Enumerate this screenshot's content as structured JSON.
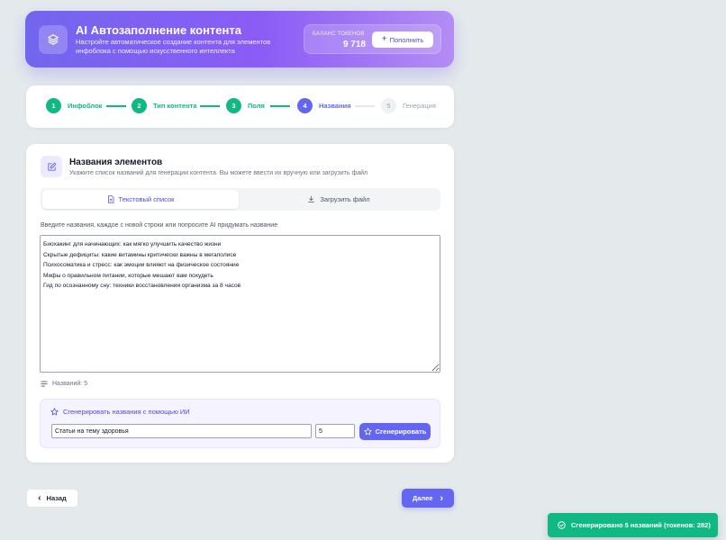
{
  "header": {
    "title": "AI Автозаполнение контента",
    "subtitle": "Настройте автоматическое создание контента для элементов инфоблока с помощью искусственного интеллекта",
    "logo_icon": "layers-icon",
    "balance_label": "БАЛАНС ТОКЕНОВ",
    "balance_value": "9 718",
    "topup_label": "Пополнить"
  },
  "steps": [
    {
      "number": "1",
      "label": "Инфоблок",
      "state": "done"
    },
    {
      "number": "2",
      "label": "Тип контента",
      "state": "done"
    },
    {
      "number": "3",
      "label": "Поля",
      "state": "done"
    },
    {
      "number": "4",
      "label": "Названия",
      "state": "active"
    },
    {
      "number": "5",
      "label": "Генерация",
      "state": "pending"
    }
  ],
  "section": {
    "title": "Названия элементов",
    "subtitle": "Укажите список названий для генерации контента. Вы можете ввести их вручную или загрузить файл",
    "icon": "edit-icon",
    "tabs": [
      {
        "label": "Текстовый список",
        "icon": "document-icon",
        "active": true
      },
      {
        "label": "Загрузить файл",
        "icon": "download-icon",
        "active": false
      }
    ],
    "textarea_label": "Введите названия, каждое с новой строки или попросите AI придумать название",
    "titles": [
      "Биохакинг для начинающих: как мягко улучшить качество жизни",
      "Скрытые дефициты: какие витамины критически важны в мегаполисе",
      "Психосоматика и стресс: как эмоции влияют на физическое состояние",
      "Мифы о правильном питании, которые мешают вам похудеть",
      "Гид по осознанному сну: техники восстановления организма за 8 часов"
    ],
    "count_text": "Названий: 5"
  },
  "ai": {
    "title": "Сгенерировать названия с помощью ИИ",
    "topic_value": "Статьи на тему здоровья",
    "count_value": "5",
    "generate_label": "Сгенерировать"
  },
  "nav": {
    "back_label": "Назад",
    "next_label": "Далее"
  },
  "toast": {
    "text": "Сгенерировано 5 названий (токенов: 282)"
  },
  "colors": {
    "accent": "#6366f1",
    "success": "#10b981",
    "header_gradient_start": "#7266ee",
    "header_gradient_end": "#b48cf4",
    "background": "#e4eaec"
  }
}
